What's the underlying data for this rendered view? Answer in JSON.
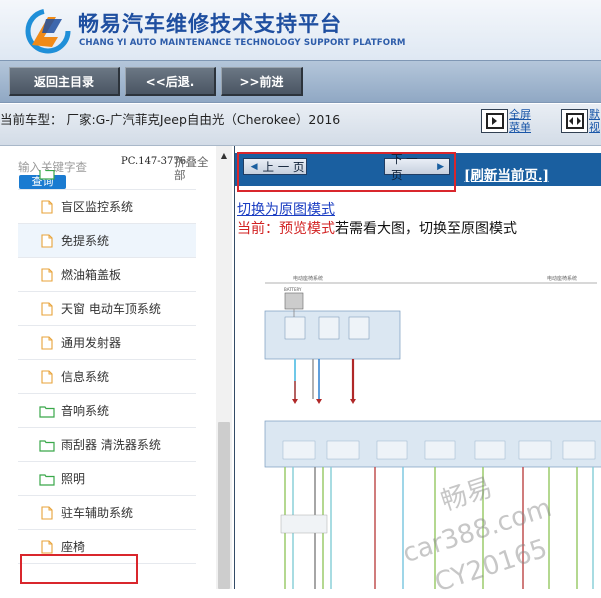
{
  "header": {
    "title_cn": "畅易汽车维修技术支持平台",
    "title_en": "CHANG YI AUTO MAINTENANCE TECHNOLOGY SUPPORT PLATFORM"
  },
  "nav": {
    "back_home": "返回主目录",
    "back": "<<后退.",
    "forward": ">>前进"
  },
  "vehicle": {
    "text": "当前车型：  厂家:G-广汽菲克Jeep自由光（Cherokee）2016"
  },
  "tools": {
    "fullscreen_line1": "全屏",
    "fullscreen_line2": "菜单",
    "second_line1": "默",
    "second_line2": "视"
  },
  "sidebar": {
    "search_placeholder": "输入关键字查",
    "query_label": "查询",
    "pc_code": "PC.147-3776",
    "collapse_all": "折叠全部",
    "items": [
      {
        "label": "盲区监控系统",
        "icon": "doc"
      },
      {
        "label": "免提系统",
        "icon": "doc"
      },
      {
        "label": "燃油箱盖板",
        "icon": "doc"
      },
      {
        "label": "天窗 电动车顶系统",
        "icon": "doc"
      },
      {
        "label": "通用发射器",
        "icon": "doc"
      },
      {
        "label": "信息系统",
        "icon": "doc"
      },
      {
        "label": "音响系统",
        "icon": "folder"
      },
      {
        "label": "雨刮器 清洗器系统",
        "icon": "folder"
      },
      {
        "label": "照明",
        "icon": "folder"
      },
      {
        "label": "驻车辅助系统",
        "icon": "doc"
      },
      {
        "label": "座椅",
        "icon": "doc"
      }
    ]
  },
  "pager": {
    "prev": "上 一 页",
    "next": "下 一 页",
    "refresh": "[刷新当前页.]"
  },
  "content": {
    "switch_link": "切换为原图模式",
    "current_prefix": "当前：",
    "current_mode": "预览模式",
    "current_suffix": "若需看大图，切换至原图模式"
  },
  "diagram": {
    "header_left": "电动座椅系统",
    "header_right": "电动座椅系统",
    "battery_label": "BATTERY"
  },
  "watermark": {
    "line1": "畅易",
    "line2": "car388.com",
    "line3": "CY20165"
  },
  "colors": {
    "brand_blue": "#1f4fa0",
    "pager_blue": "#1a5fa0",
    "highlight_red": "#d9262c",
    "link_blue": "#1a3dc2",
    "mode_red": "#d22222"
  }
}
